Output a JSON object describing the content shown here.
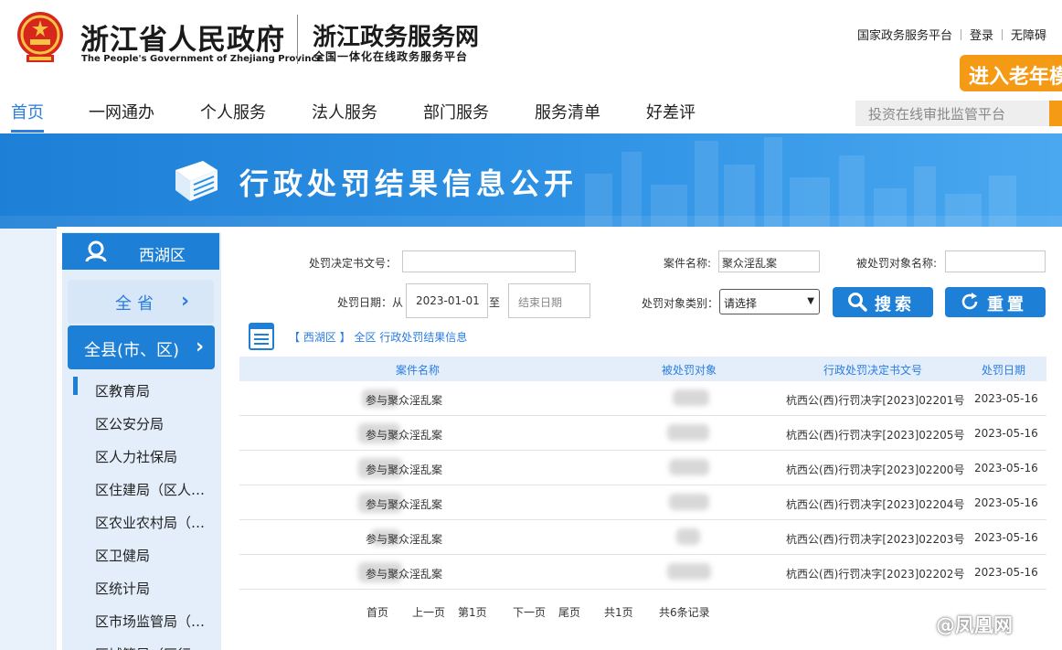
{
  "header": {
    "gov_title": "浙江省人民政府",
    "gov_en": "The People's Government of Zhejiang Province",
    "svc_title": "浙江政务服务网",
    "svc_subtitle": "全国一体化在线政务服务平台",
    "links": [
      "国家政务服务平台",
      "登录",
      "无障碍"
    ],
    "elder_mode": "进入老年模式"
  },
  "nav": {
    "items": [
      "首页",
      "一网通办",
      "个人服务",
      "法人服务",
      "部门服务",
      "服务清单",
      "好差评"
    ],
    "active_index": 0,
    "search_placeholder": "投资在线审批监管平台"
  },
  "banner": {
    "title": "行政处罚结果信息公开"
  },
  "sidebar": {
    "region": "西湖区",
    "all_province": "全省",
    "all_county": "全县(市、区)",
    "departments": [
      "区教育局",
      "区公安分局",
      "区人力社保局",
      "区住建局（区人防办）",
      "区农业农村局（区林水局）",
      "区卫健局",
      "区统计局",
      "区市场监管局（区知识产权局）",
      "区城管局（区行政执法局）"
    ]
  },
  "form": {
    "doc_no_label": "处罚决定书文号：",
    "doc_no_value": "",
    "case_name_label": "案件名称:",
    "case_name_value": "聚众淫乱案",
    "target_name_label": "被处罚对象名称:",
    "target_name_value": "",
    "date_label": "处罚日期：从",
    "date_from": "2023-01-01",
    "date_to_label": "至",
    "date_to_placeholder": "结束日期",
    "target_type_label": "处罚对象类别：",
    "target_type_value": "请选择",
    "search_button": "搜索",
    "reset_button": "重置"
  },
  "breadcrumb": {
    "region": "【 西湖区 】",
    "title": "全区 行政处罚结果信息"
  },
  "table": {
    "columns": [
      "案件名称",
      "被处罚对象",
      "行政处罚决定书文号",
      "处罚日期"
    ],
    "rows": [
      {
        "name": "参与聚众淫乱案",
        "doc_no": "杭西公(西)行罚决字[2023]02201号",
        "date": "2023-05-16"
      },
      {
        "name": "参与聚众淫乱案",
        "doc_no": "杭西公(西)行罚决字[2023]02205号",
        "date": "2023-05-16"
      },
      {
        "name": "参与聚众淫乱案",
        "doc_no": "杭西公(西)行罚决字[2023]02200号",
        "date": "2023-05-16"
      },
      {
        "name": "参与聚众淫乱案",
        "doc_no": "杭西公(西)行罚决字[2023]02204号",
        "date": "2023-05-16"
      },
      {
        "name": "参与聚众淫乱案",
        "doc_no": "杭西公(西)行罚决字[2023]02203号",
        "date": "2023-05-16"
      },
      {
        "name": "参与聚众淫乱案",
        "doc_no": "杭西公(西)行罚决字[2023]02202号",
        "date": "2023-05-16"
      }
    ]
  },
  "pager": {
    "first": "首页",
    "prev": "上一页",
    "current": "第1页",
    "next": "下一页",
    "last": "尾页",
    "total_pages": "共1页",
    "total_records": "共6条记录"
  },
  "watermark": "@凤凰网",
  "colors": {
    "brand_blue": "#1e7fd6",
    "accent_orange": "#f49a14",
    "link_blue": "#2b7de1"
  },
  "icons": [
    "national-emblem-icon",
    "book-icon",
    "location-pin-icon",
    "chevron-right-icon",
    "document-list-icon",
    "search-icon",
    "refresh-icon",
    "weibo-icon"
  ]
}
